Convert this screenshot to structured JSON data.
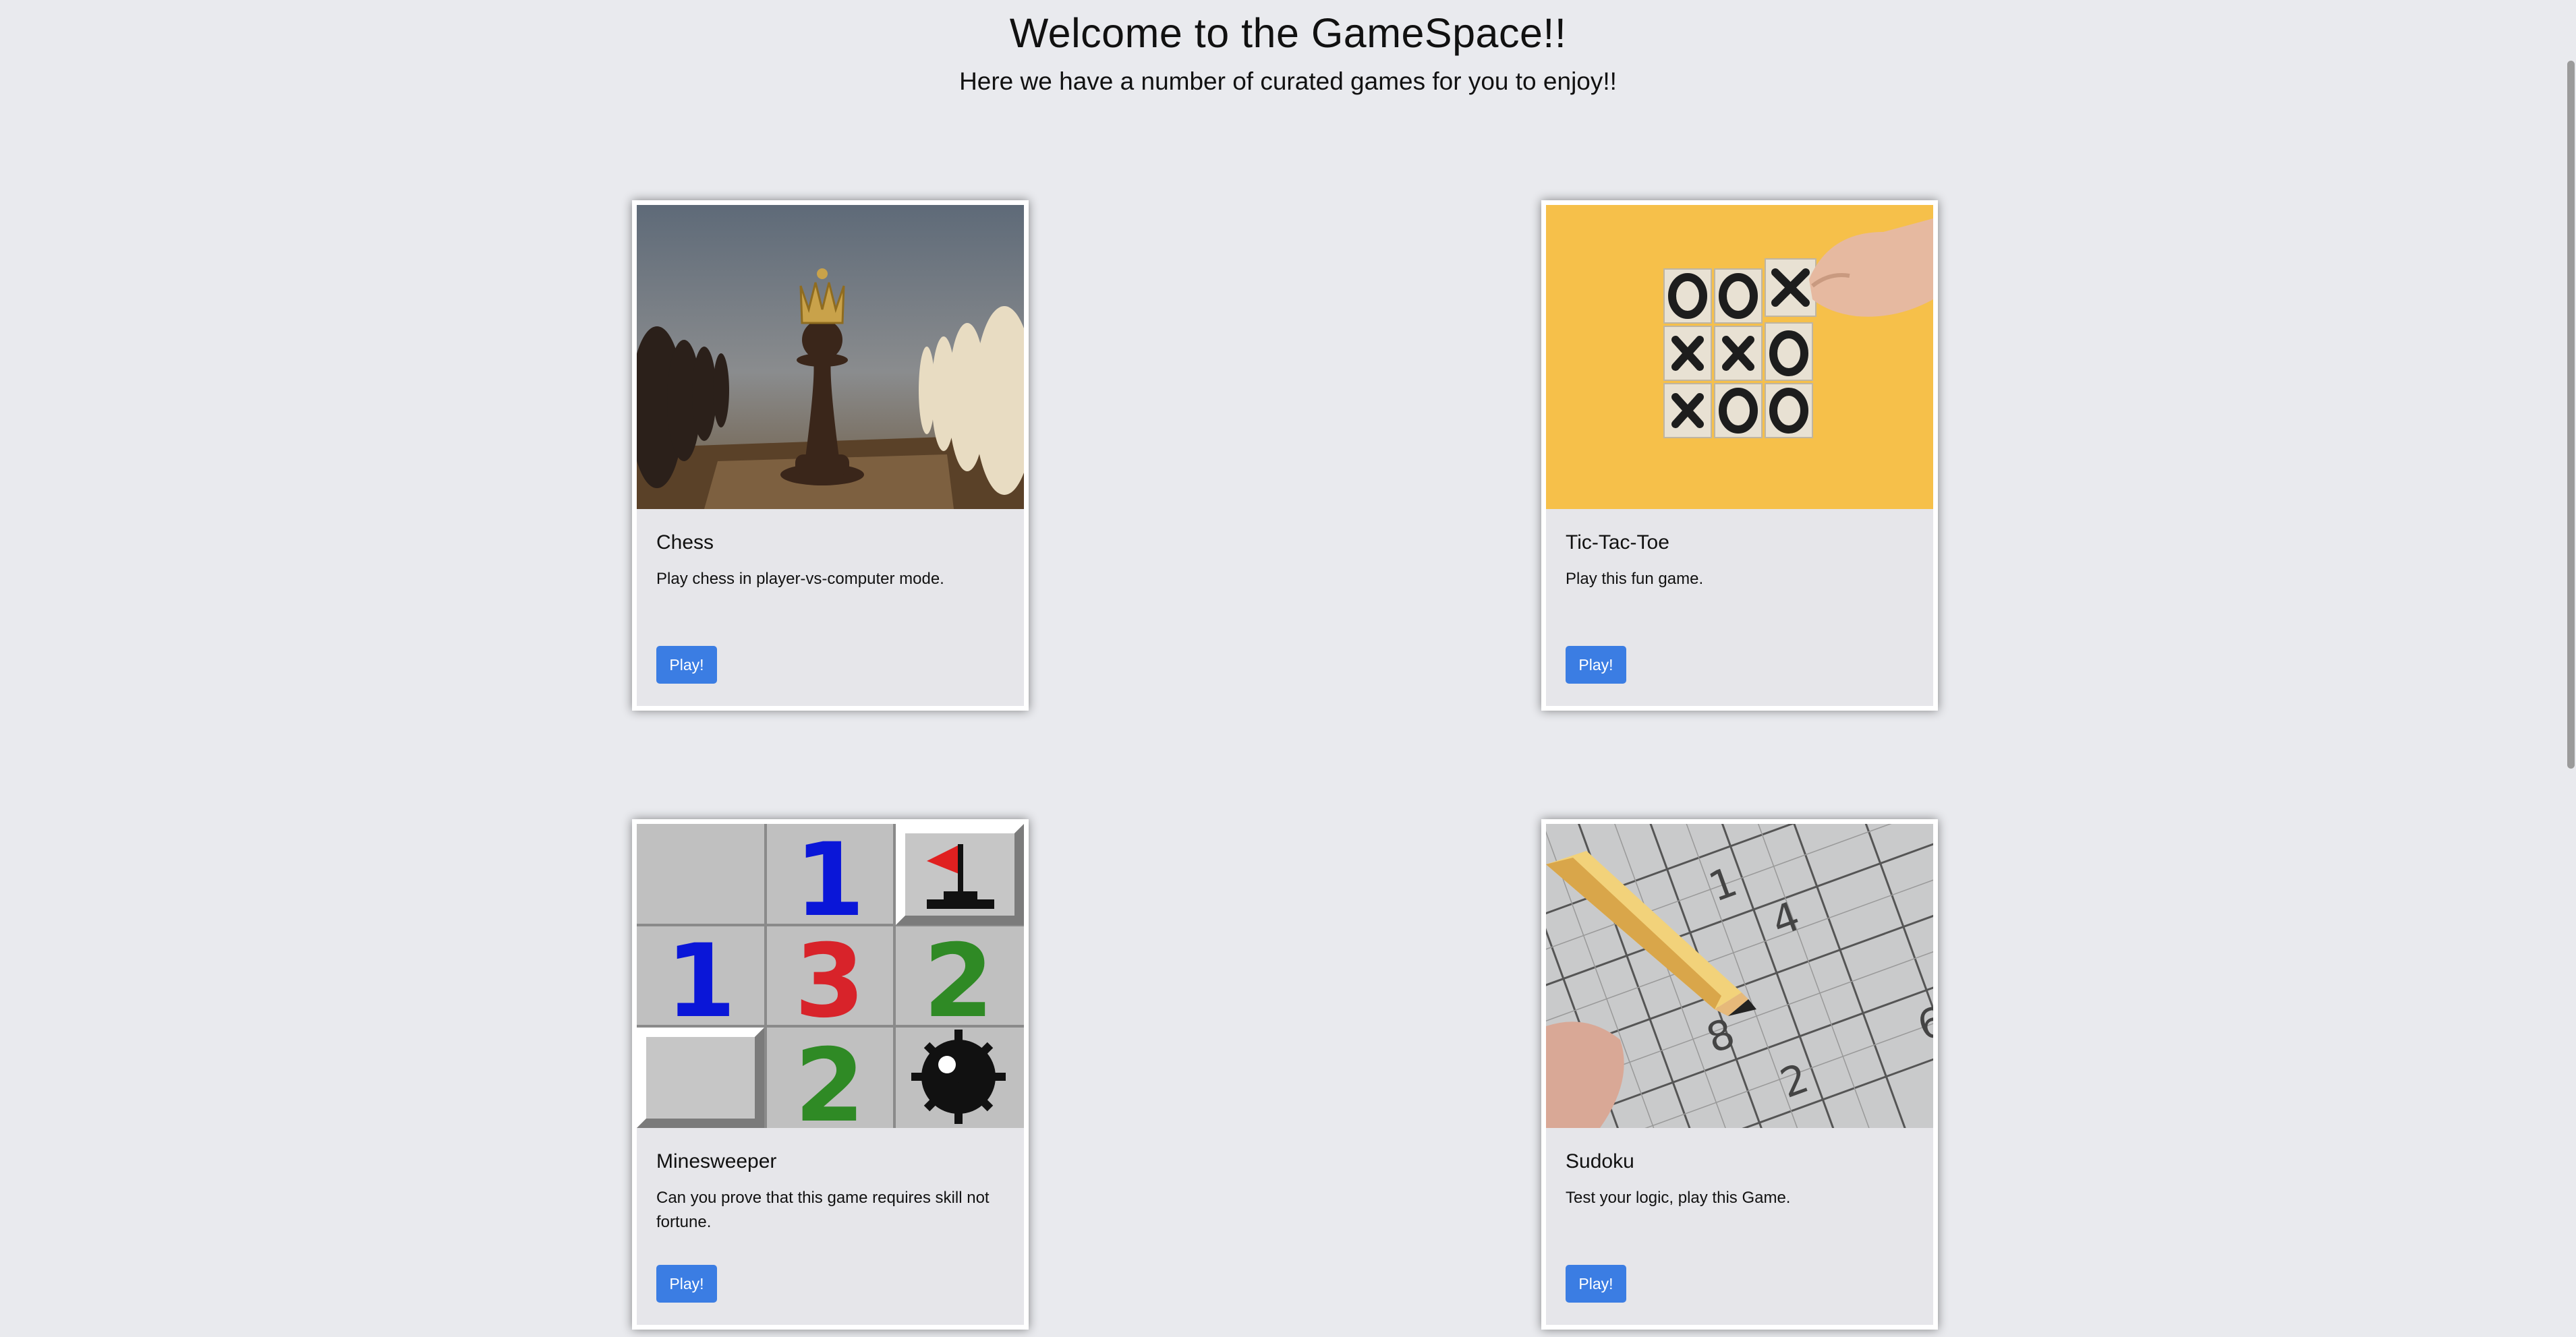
{
  "header": {
    "title": "Welcome to the GameSpace!!",
    "subtitle": "Here we have a number of curated games for you to enjoy!!"
  },
  "games": [
    {
      "title": "Chess",
      "description": "Play chess in player-vs-computer mode.",
      "button_label": "Play!",
      "image": "chess-pieces-photo"
    },
    {
      "title": "Tic-Tac-Toe",
      "description": "Play this fun game.",
      "button_label": "Play!",
      "image": "tic-tac-toe-tiles-photo"
    },
    {
      "title": "Minesweeper",
      "description": "Can you prove that this game requires skill not fortune.",
      "button_label": "Play!",
      "image": "minesweeper-grid-image"
    },
    {
      "title": "Sudoku",
      "description": "Test your logic, play this Game.",
      "button_label": "Play!",
      "image": "sudoku-pencil-photo"
    }
  ],
  "colors": {
    "background": "#e9eaee",
    "card": "#e6e6ea",
    "button": "#3b7de3"
  }
}
